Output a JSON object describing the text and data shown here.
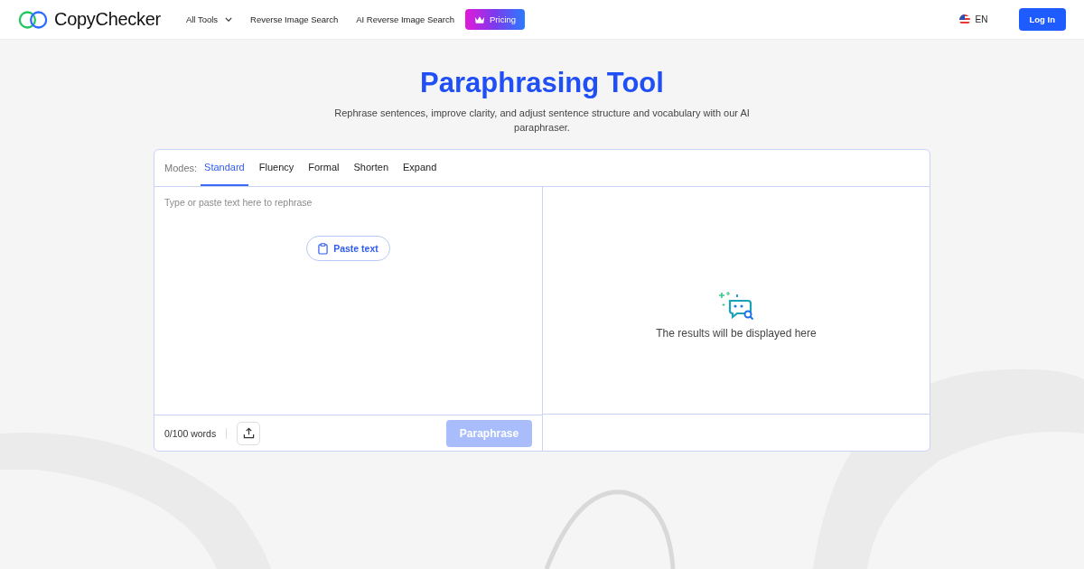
{
  "header": {
    "brand": "CopyChecker",
    "nav": [
      {
        "label": "All Tools",
        "kind": "dropdown"
      },
      {
        "label": "Reverse Image Search",
        "kind": "link"
      },
      {
        "label": "AI Reverse Image Search",
        "kind": "link"
      },
      {
        "label": "Pricing",
        "kind": "pricing"
      }
    ],
    "language": "EN",
    "login": "Log In"
  },
  "hero": {
    "title": "Paraphrasing Tool",
    "subtitle": "Rephrase sentences, improve clarity, and adjust sentence structure and vocabulary with our AI paraphraser."
  },
  "editor": {
    "modes_label": "Modes:",
    "modes": [
      {
        "label": "Standard",
        "selected": true
      },
      {
        "label": "Fluency",
        "selected": false
      },
      {
        "label": "Formal",
        "selected": false
      },
      {
        "label": "Shorten",
        "selected": false
      },
      {
        "label": "Expand",
        "selected": false
      }
    ],
    "input": {
      "placeholder": "Type or paste text here to rephrase"
    },
    "paste_button": "Paste text",
    "word_count": "0/100 words",
    "paraphrase_button": {
      "label": "Paraphrase",
      "disabled": true
    },
    "output": {
      "placeholder": "The results will be displayed here"
    }
  }
}
